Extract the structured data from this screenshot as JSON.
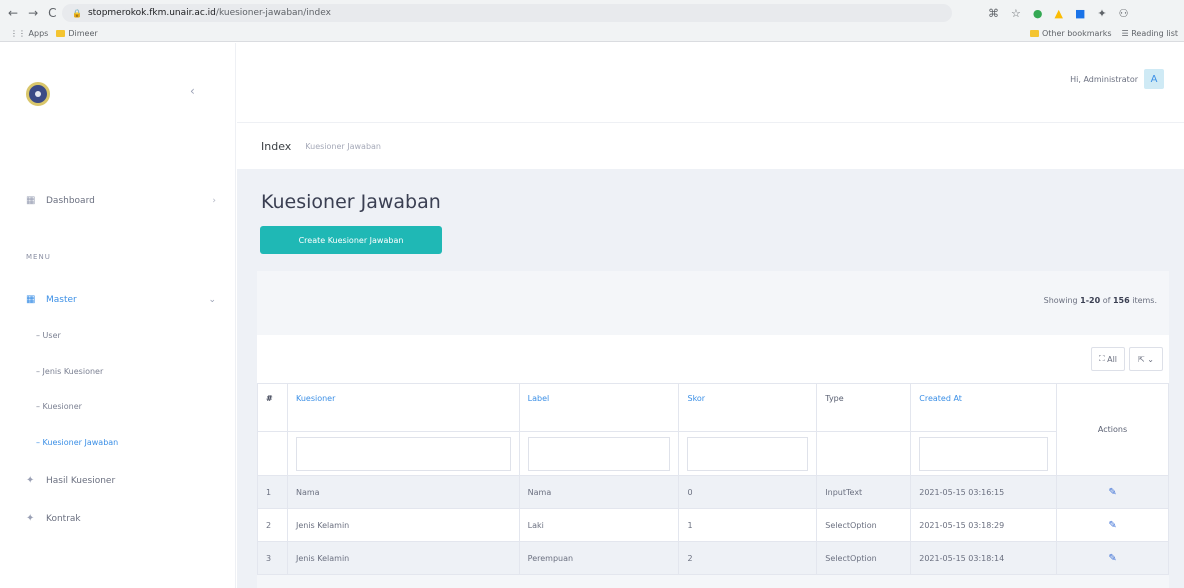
{
  "browser": {
    "url_host": "stopmerokok.fkm.unair.ac.id",
    "url_path": "/kuesioner-jawaban/index",
    "bookmarks": {
      "apps": "Apps",
      "folder": "Dimeer",
      "other": "Other bookmarks",
      "reading": "Reading list"
    }
  },
  "sidebar": {
    "dashboard": "Dashboard",
    "menu_title": "MENU",
    "master": "Master",
    "sub_items": [
      "User",
      "Jenis Kuesioner",
      "Kuesioner",
      "Kuesioner Jawaban"
    ],
    "active_sub": 3,
    "hasil": "Hasil Kuesioner",
    "kontrak": "Kontrak"
  },
  "header": {
    "greeting": "Hi, Administrator",
    "avatar_initial": "A"
  },
  "breadcrumb": {
    "current": "Index",
    "parent": "Kuesioner Jawaban"
  },
  "page": {
    "title": "Kuesioner Jawaban",
    "create_button": "Create Kuesioner Jawaban",
    "summary_prefix": "Showing ",
    "summary_range": "1-20",
    "summary_of": " of ",
    "summary_total": "156",
    "summary_suffix": " items.",
    "toolbar_all": "All"
  },
  "table": {
    "columns": [
      "#",
      "Kuesioner",
      "Label",
      "Skor",
      "Type",
      "Created At",
      "Actions"
    ],
    "rows": [
      {
        "no": "1",
        "kuesioner": "Nama",
        "label": "Nama",
        "skor": "0",
        "type": "InputText",
        "created_at": "2021-05-15 03:16:15"
      },
      {
        "no": "2",
        "kuesioner": "Jenis Kelamin",
        "label": "Laki",
        "skor": "1",
        "type": "SelectOption",
        "created_at": "2021-05-15 03:18:29"
      },
      {
        "no": "3",
        "kuesioner": "Jenis Kelamin",
        "label": "Perempuan",
        "skor": "2",
        "type": "SelectOption",
        "created_at": "2021-05-15 03:18:14"
      }
    ]
  },
  "icons": {
    "edit": "pencil-icon",
    "export": "export-icon",
    "expand": "expand-icon"
  }
}
